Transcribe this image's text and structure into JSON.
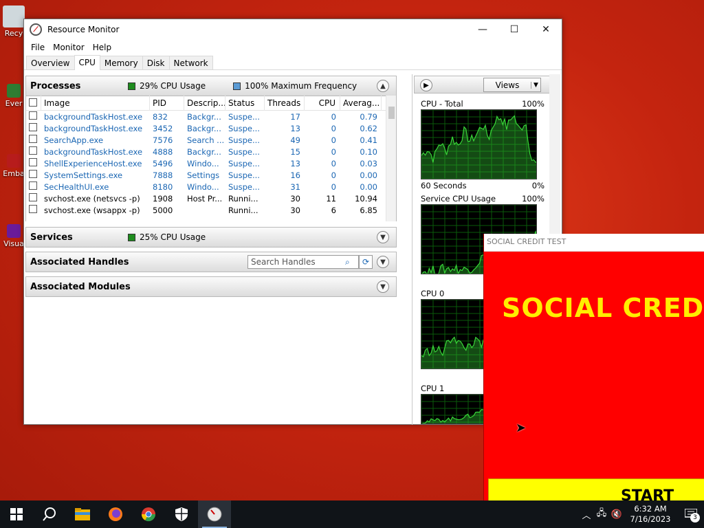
{
  "desktop": {
    "icons": [
      {
        "label": "Recy",
        "color": "#cfd8dc"
      },
      {
        "label": "Ever",
        "color": "#2e7d32"
      },
      {
        "label": "Emba",
        "color": "#b71c1c"
      },
      {
        "label": "Visua",
        "color": "#6a1b9a"
      }
    ]
  },
  "resource_monitor": {
    "title": "Resource Monitor",
    "menu": [
      "File",
      "Monitor",
      "Help"
    ],
    "tabs": [
      "Overview",
      "CPU",
      "Memory",
      "Disk",
      "Network"
    ],
    "active_tab": "CPU",
    "processes": {
      "title": "Processes",
      "cpu_usage": "29% CPU Usage",
      "max_freq": "100% Maximum Frequency",
      "columns": [
        "Image",
        "PID",
        "Descrip...",
        "Status",
        "Threads",
        "CPU",
        "Averag..."
      ],
      "rows": [
        {
          "image": "backgroundTaskHost.exe",
          "pid": "832",
          "desc": "Backgr...",
          "status": "Suspe...",
          "threads": "17",
          "cpu": "0",
          "avg": "0.79",
          "suspended": true
        },
        {
          "image": "backgroundTaskHost.exe",
          "pid": "3452",
          "desc": "Backgr...",
          "status": "Suspe...",
          "threads": "13",
          "cpu": "0",
          "avg": "0.62",
          "suspended": true
        },
        {
          "image": "SearchApp.exe",
          "pid": "7576",
          "desc": "Search ...",
          "status": "Suspe...",
          "threads": "49",
          "cpu": "0",
          "avg": "0.41",
          "suspended": true
        },
        {
          "image": "backgroundTaskHost.exe",
          "pid": "4888",
          "desc": "Backgr...",
          "status": "Suspe...",
          "threads": "15",
          "cpu": "0",
          "avg": "0.10",
          "suspended": true
        },
        {
          "image": "ShellExperienceHost.exe",
          "pid": "5496",
          "desc": "Windo...",
          "status": "Suspe...",
          "threads": "13",
          "cpu": "0",
          "avg": "0.03",
          "suspended": true
        },
        {
          "image": "SystemSettings.exe",
          "pid": "7888",
          "desc": "Settings",
          "status": "Suspe...",
          "threads": "16",
          "cpu": "0",
          "avg": "0.00",
          "suspended": true
        },
        {
          "image": "SecHealthUI.exe",
          "pid": "8180",
          "desc": "Windo...",
          "status": "Suspe...",
          "threads": "31",
          "cpu": "0",
          "avg": "0.00",
          "suspended": true
        },
        {
          "image": "svchost.exe (netsvcs -p)",
          "pid": "1908",
          "desc": "Host Pr...",
          "status": "Runni...",
          "threads": "30",
          "cpu": "11",
          "avg": "10.94",
          "suspended": false
        },
        {
          "image": "svchost.exe (wsappx -p)",
          "pid": "5000",
          "desc": "",
          "status": "Runni...",
          "threads": "30",
          "cpu": "6",
          "avg": "6.85",
          "suspended": false
        }
      ]
    },
    "services": {
      "title": "Services",
      "cpu_usage": "25% CPU Usage"
    },
    "handles": {
      "title": "Associated Handles",
      "search_placeholder": "Search Handles"
    },
    "modules": {
      "title": "Associated Modules"
    },
    "right_panel": {
      "views_label": "Views",
      "graphs": [
        {
          "name": "CPU - Total",
          "max": "100%",
          "foot_left": "60 Seconds",
          "foot_right": "0%"
        },
        {
          "name": "Service CPU Usage",
          "max": "100%"
        },
        {
          "name": "CPU 0"
        },
        {
          "name": "CPU 1"
        }
      ]
    },
    "colors": {
      "cpu_usage": "#1e8c1e",
      "max_freq": "#5b9bd5",
      "graph_line": "#39d639",
      "graph_grid": "#0a5a0a"
    }
  },
  "social_credit": {
    "title": "SOCIAL CREDIT TEST",
    "heading": "SOCIAL CREDIT",
    "start": "START",
    "bg": "#ff0000",
    "heading_color": "#ffee00"
  },
  "taskbar": {
    "apps": [
      "windows-start-icon",
      "search-icon",
      "file-explorer-icon",
      "firefox-icon",
      "chrome-icon",
      "security-shield-icon",
      "resource-monitor-icon"
    ],
    "time": "6:32 AM",
    "date": "7/16/2023",
    "notifications": "3"
  }
}
